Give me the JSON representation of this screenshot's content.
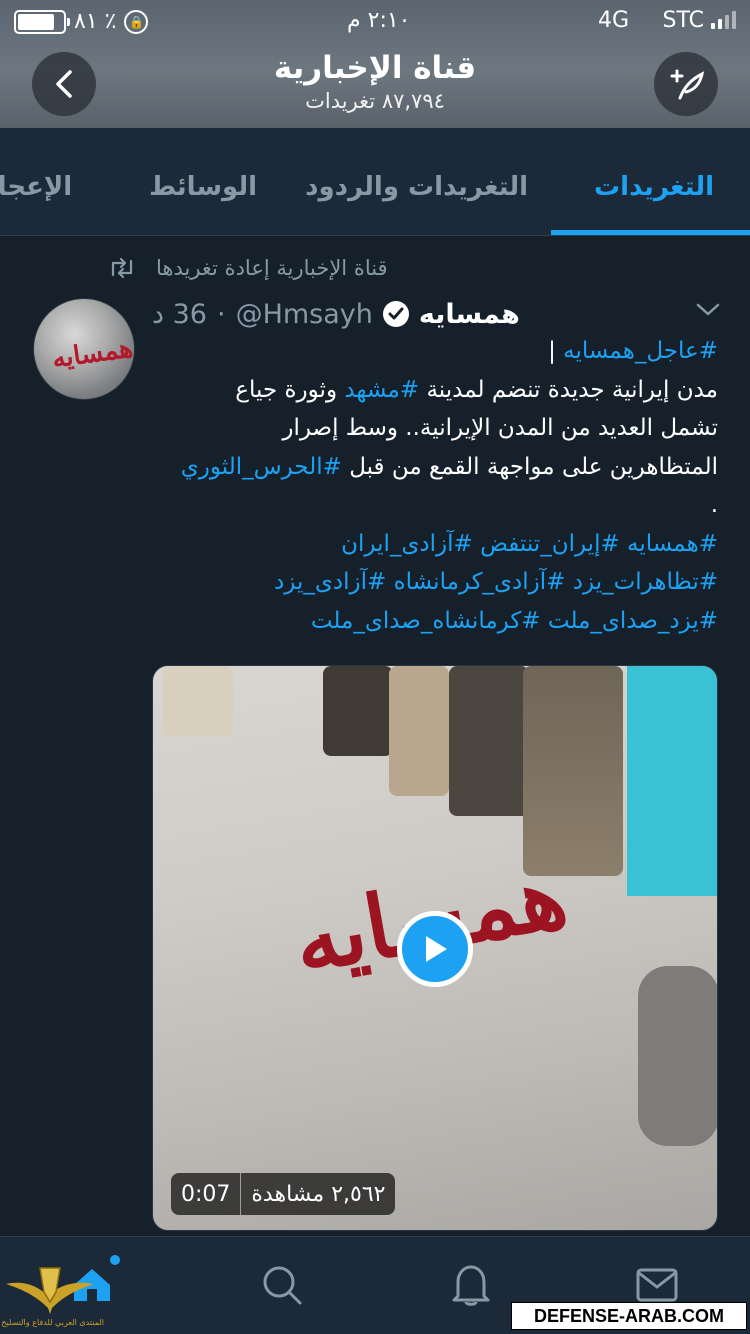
{
  "status_bar": {
    "carrier": "STC",
    "network": "4G",
    "time": "٢:١٠ م",
    "battery_percent": "٨١ ٪",
    "battery_level": 0.81
  },
  "header": {
    "title": "قناة الإخبارية",
    "subtitle": "٨٧,٧٩٤ تغريدات",
    "back_icon": "chevron-left-icon",
    "compose_icon": "compose-tweet-icon"
  },
  "tabs": [
    {
      "label": "التغريدات",
      "active": true
    },
    {
      "label": "التغريدات والردود",
      "active": false
    },
    {
      "label": "الوسائط",
      "active": false
    },
    {
      "label": "الإعجابات",
      "active": false
    }
  ],
  "tweet": {
    "retweet_text": "قناة الإخبارية إعادة تغريدها",
    "name": "همسايه",
    "handle": "@Hmsayh",
    "time": "36 د",
    "separator": "·",
    "body": {
      "line1_tag": "#عاجل_همسايه",
      "line1_suffix": " |",
      "line2_a": "مدن إيرانية جديدة تنضم لمدينة ",
      "line2_tag": "#مشهد",
      "line2_b": " وثورة جياع",
      "line3": "تشمل العديد من المدن الإيرانية.. وسط إصرار",
      "line4_a": "المتظاهرين على مواجهة القمع من قبل ",
      "line4_tag": "#الحرس_الثوري",
      "line5": ".",
      "tags_line6": "#همسايه #إيران_تنتفض #آزادی_ایران",
      "tags_line7": "#تظاهرات_یزد #آزادی_کرمانشاه #آزادی_یزد",
      "tags_line8": "#یزد_صدای_ملت #کرمانشاه_صدای_ملت"
    },
    "video": {
      "views": "٢,٥٦٢ مشاهدة",
      "duration": "0:07",
      "watermark": "همسایه"
    }
  },
  "bottom_nav": {
    "items": [
      "home-icon",
      "search-icon",
      "notifications-icon",
      "messages-icon"
    ]
  },
  "overlay": {
    "site_label": "DEFENSE-ARAB.COM",
    "logo_caption": "المنتدى العربي للدفاع والتسليح"
  },
  "colors": {
    "accent": "#1da1f2",
    "background": "#15202b",
    "secondary_text": "#8899a6"
  }
}
